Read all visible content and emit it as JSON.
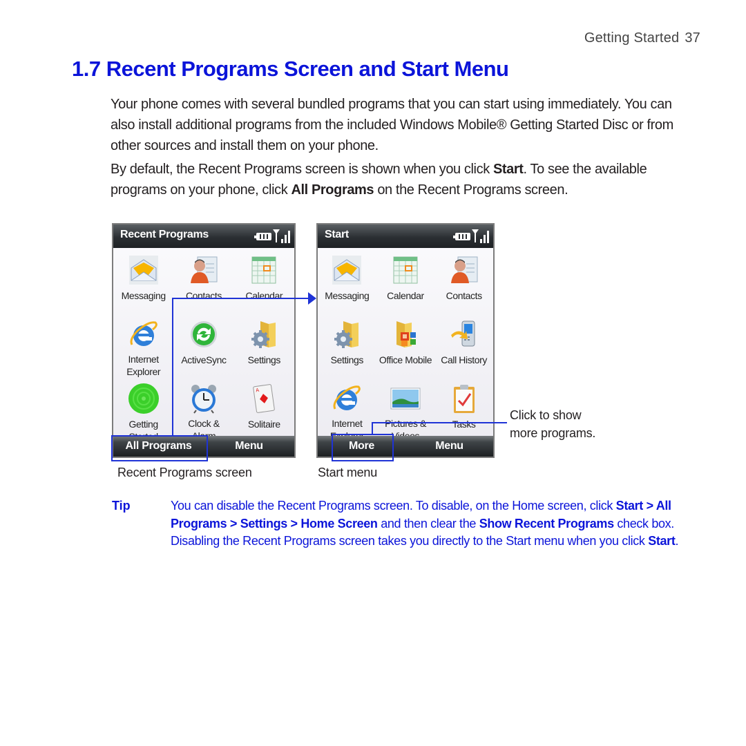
{
  "header": {
    "chapter": "Getting Started",
    "page_number": "37"
  },
  "section": {
    "title": "1.7 Recent Programs Screen and Start Menu"
  },
  "body": {
    "paragraph1": "Your phone comes with several bundled programs that you can start using immediately. You can also install additional programs from the included Windows Mobile® Getting Started Disc or from other sources and install them on your phone.",
    "paragraph2": {
      "part1": "By default, the Recent Programs screen is shown when you click ",
      "bold1": "Start",
      "part2": ". To see the available programs on your phone, click ",
      "bold2": "All Programs",
      "part3": " on the Recent Programs screen."
    }
  },
  "recent_programs_screen": {
    "title": "Recent Programs",
    "apps": [
      {
        "label": "Messaging",
        "icon": "envelope-icon"
      },
      {
        "label": "Contacts",
        "icon": "contacts-icon"
      },
      {
        "label": "Calendar",
        "icon": "calendar-icon"
      },
      {
        "label": "Internet\nExplorer",
        "icon": "internet-explorer-icon"
      },
      {
        "label": "ActiveSync",
        "icon": "activesync-icon"
      },
      {
        "label": "Settings",
        "icon": "settings-folder-icon"
      },
      {
        "label": "Getting\nStarted",
        "icon": "getting-started-icon"
      },
      {
        "label": "Clock &\nAlarm",
        "icon": "alarm-clock-icon"
      },
      {
        "label": "Solitaire",
        "icon": "playing-card-icon"
      }
    ],
    "left_softkey": "All Programs",
    "right_softkey": "Menu",
    "caption": "Recent Programs screen"
  },
  "start_menu_screen": {
    "title": "Start",
    "apps": [
      {
        "label": "Messaging",
        "icon": "envelope-icon"
      },
      {
        "label": "Calendar",
        "icon": "calendar-icon"
      },
      {
        "label": "Contacts",
        "icon": "contacts-icon"
      },
      {
        "label": "Settings",
        "icon": "settings-folder-icon"
      },
      {
        "label": "Office Mobile",
        "icon": "office-folder-icon"
      },
      {
        "label": "Call History",
        "icon": "call-history-icon"
      },
      {
        "label": "Internet\nExplorer",
        "icon": "internet-explorer-icon"
      },
      {
        "label": "Pictures &\nVideos",
        "icon": "pictures-icon"
      },
      {
        "label": "Tasks",
        "icon": "tasks-clipboard-icon"
      }
    ],
    "left_softkey": "More",
    "right_softkey": "Menu",
    "caption": "Start menu"
  },
  "callout": {
    "more_line1": "Click to show",
    "more_line2": "more programs."
  },
  "tip": {
    "label": "Tip",
    "text1": "You can disable the Recent Programs screen. To disable, on the Home screen, click ",
    "bold1": "Start > All Programs > Settings > Home Screen",
    "text2": " and then clear the ",
    "bold2": "Show Recent Programs",
    "text3": " check box. Disabling the Recent Programs screen takes you directly to the Start menu when you click ",
    "bold3": "Start",
    "text4": "."
  },
  "colors": {
    "heading_blue": "#0b14d9",
    "callout_blue": "#1f33d6",
    "body_text": "#231f20"
  }
}
